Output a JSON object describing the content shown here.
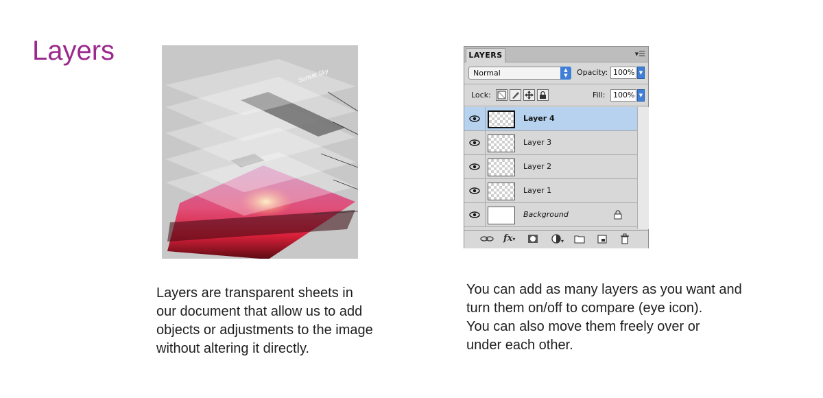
{
  "title": "Layers",
  "left_paragraph": "Layers are transparent sheets in\nour document that allow us to add\nobjects or adjustments to the image\nwithout altering it directly.",
  "right_paragraph": "You can add as many layers as you want and\nturn them on/off to compare (eye icon).\nYou can also move them freely over or\nunder each other.",
  "illustration": {
    "sheet_text": "Sunset Sky"
  },
  "panel": {
    "tab_label": "LAYERS",
    "blend_mode": "Normal",
    "opacity_label": "Opacity:",
    "opacity_value": "100%",
    "lock_label": "Lock:",
    "fill_label": "Fill:",
    "fill_value": "100%",
    "layers": [
      {
        "name": "Layer 4",
        "selected": true
      },
      {
        "name": "Layer 3",
        "selected": false
      },
      {
        "name": "Layer 2",
        "selected": false
      },
      {
        "name": "Layer 1",
        "selected": false
      },
      {
        "name": "Background",
        "selected": false,
        "locked": true
      }
    ],
    "footer_icons": [
      "link-icon",
      "fx-icon",
      "mask-icon",
      "adjustment-icon",
      "folder-icon",
      "new-layer-icon",
      "trash-icon"
    ]
  },
  "colors": {
    "title": "#9b2a8c",
    "selected_row": "#b6d2ef",
    "accent_blue": "#3f7fd8"
  }
}
